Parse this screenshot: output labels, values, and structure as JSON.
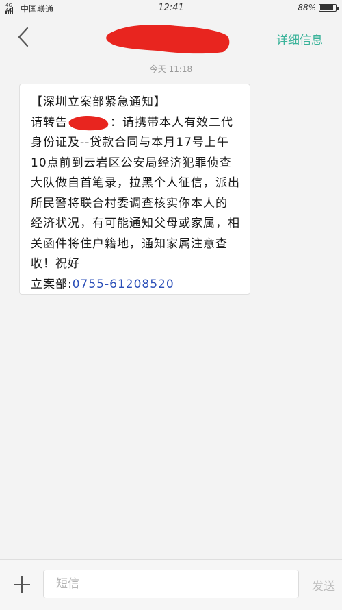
{
  "status_bar": {
    "network": "4G 4G",
    "carrier": "中国联通",
    "time": "12:41",
    "battery": "88%",
    "battery_level": 0.88
  },
  "nav": {
    "back_icon": "chevron-left-icon",
    "details_label": "详细信息"
  },
  "conversation": {
    "timestamp": "今天  11:18",
    "message": {
      "lines": [
        "【深圳立案部紧急通知】",
        "请转告",
        "：请携带本人有效二代",
        "身份证及--贷款合同与本月17号上午",
        "10点前到云岩区公安局经济犯罪侦查",
        "大队做自首笔录，拉黑个人征信，派出",
        "所民警将联合村委调查核实你本人的",
        "经济状况，有可能通知父母或家属，相",
        "关函件将住户籍地，通知家属注意查",
        "收！祝好"
      ],
      "sender_prefix": "立案部:",
      "phone": "0755-61208520"
    }
  },
  "composer": {
    "add_icon": "plus-icon",
    "placeholder": "短信",
    "value": "",
    "send_label": "发送"
  },
  "colors": {
    "accent": "#3bb39a",
    "redaction": "#e8251f",
    "link": "#2b4fb8"
  }
}
